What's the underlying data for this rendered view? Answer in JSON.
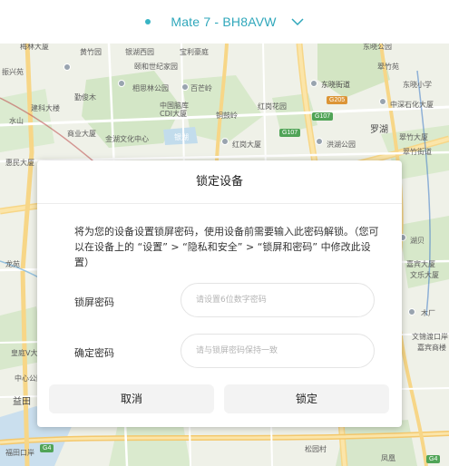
{
  "header": {
    "device_name": "Mate 7 - BH8AVW",
    "dot_color": "#38b4c4",
    "dropdown_icon": "chevron-down-icon"
  },
  "map": {
    "labels": [
      "梅林大厦",
      "黄竹园",
      "颐和世纪家园",
      "东晓公园",
      "东晓街道",
      "东晓小学",
      "振兴苑",
      "银湖西园",
      "宝利豪庭",
      "翠竹苑",
      "勤俊木",
      "相思林公园",
      "百芒岭",
      "建科大楼",
      "中国脑库CDI大厦",
      "铜鼓岭",
      "中深石化大厦",
      "商业大厦",
      "金湖文化中心",
      "银湖",
      "红岗花园",
      "罗湖",
      "翠竹大厦",
      "水山",
      "红岗大厦",
      "洪湖公园",
      "翠竹街道",
      "惠民大厦",
      "龙苑",
      "湖贝",
      "嘉宾大厦",
      "文乐大厦",
      "木厂",
      "文锦渡口岸",
      "嘉宾商楼",
      "皇庭V大厦",
      "中心公园",
      "益田",
      "福田口岸",
      "松园村",
      "凤凰"
    ],
    "road_signs": [
      "G205",
      "G107",
      "G107",
      "G4",
      "G4"
    ]
  },
  "dialog": {
    "title": "锁定设备",
    "description": "将为您的设备设置锁屏密码，使用设备前需要输入此密码解锁。（您可以在设备上的 “设置” > “隐私和安全” > “锁屏和密码” 中修改此设置）",
    "fields": [
      {
        "label": "锁屏密码",
        "placeholder": "请设置6位数字密码"
      },
      {
        "label": "确定密码",
        "placeholder": "请与锁屏密码保持一致"
      }
    ],
    "cancel_label": "取消",
    "confirm_label": "锁定"
  }
}
